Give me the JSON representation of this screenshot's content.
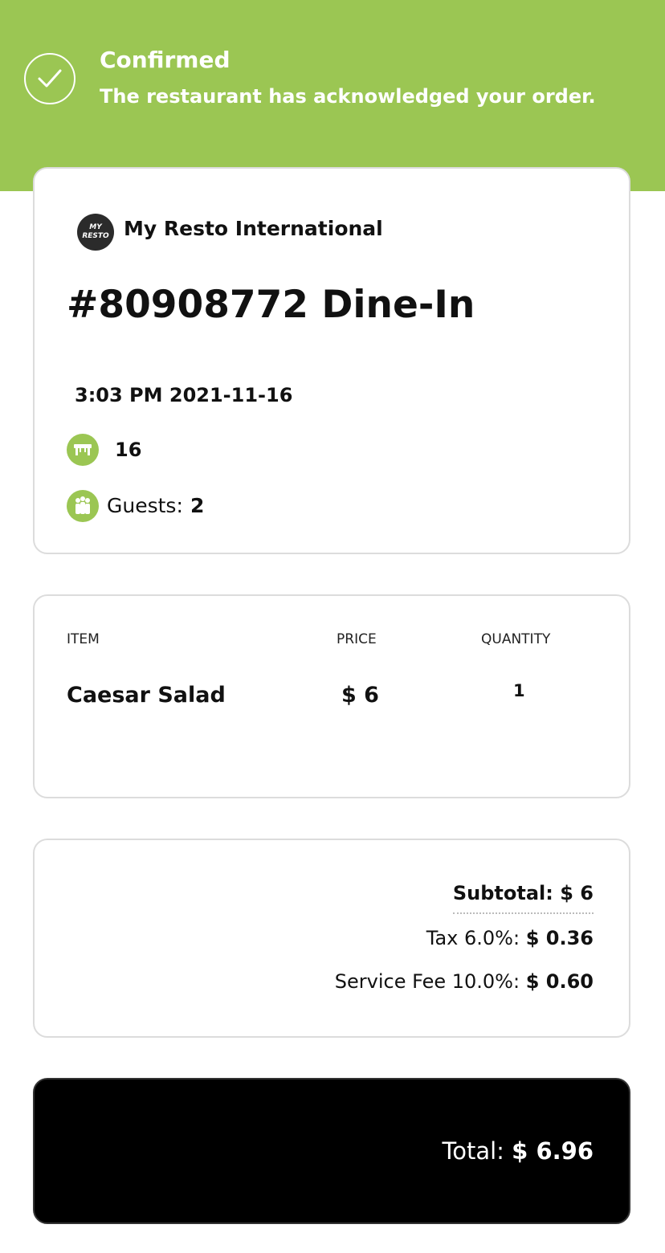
{
  "banner": {
    "title": "Confirmed",
    "subtitle": "The restaurant has acknowledged your order.",
    "color": "#9bc653"
  },
  "restaurant": {
    "logo_line1": "MY",
    "logo_line2": "RESTO",
    "name": "My Resto International"
  },
  "order": {
    "title": "#80908772 Dine-In",
    "time": "3:03 PM 2021-11-16",
    "table_number": "16",
    "guests_label": "Guests:",
    "guests_value": "2"
  },
  "items_table": {
    "headers": [
      "ITEM",
      "PRICE",
      "QUANTITY"
    ],
    "rows": [
      {
        "name": "Caesar Salad",
        "price": "$ 6",
        "quantity": "1"
      }
    ]
  },
  "totals": {
    "subtotal_label": "Subtotal:",
    "subtotal_value": "$ 6",
    "tax_label": "Tax 6.0%:",
    "tax_value": "$ 0.36",
    "fee_label": "Service Fee 10.0%:",
    "fee_value": "$ 0.60",
    "total_label": "Total:",
    "total_value": "$ 6.96"
  },
  "icons": {
    "confirm": "check-icon",
    "table": "table-icon",
    "guests": "guests-icon"
  }
}
